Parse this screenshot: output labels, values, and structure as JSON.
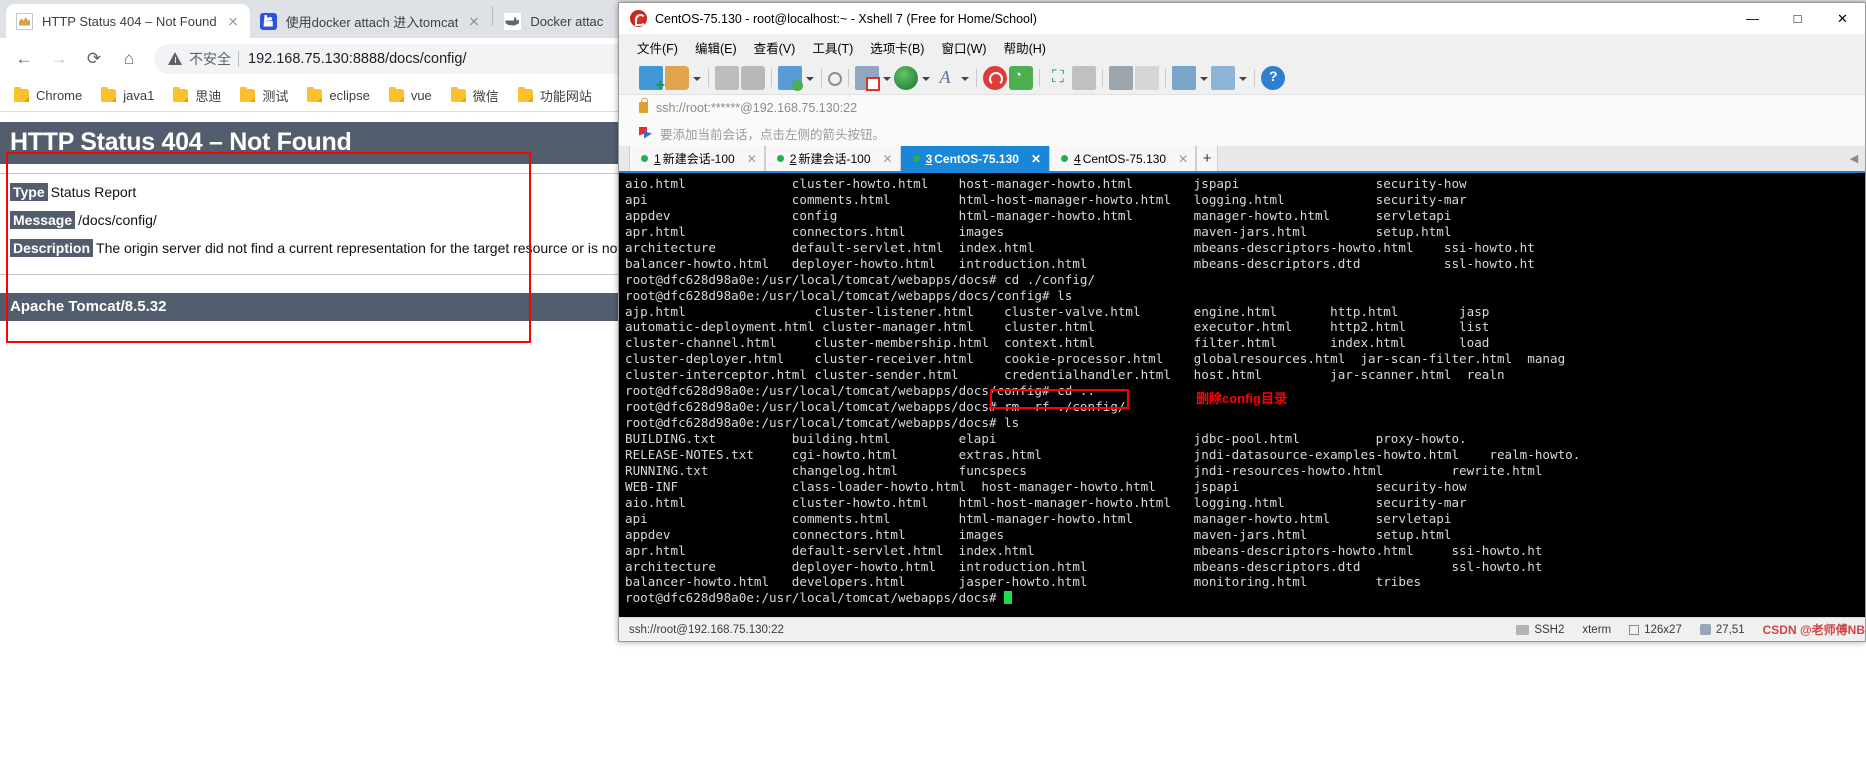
{
  "browser": {
    "tabs": [
      {
        "title": "HTTP Status 404 – Not Found",
        "favicon": "tomcat-icon",
        "active": true
      },
      {
        "title": "使用docker attach 进入tomcat",
        "favicon": "baidu-icon",
        "active": false
      },
      {
        "title": "Docker attac",
        "favicon": "docker-icon",
        "active": false
      }
    ],
    "toolbar": {
      "back": "←",
      "forward": "→",
      "reload": "⟳",
      "home": "⌂",
      "insecure_label": "不安全",
      "url": "192.168.75.130:8888/docs/config/"
    },
    "bookmarks": [
      "Chrome",
      "java1",
      "思迪",
      "测试",
      "eclipse",
      "vue",
      "微信",
      "功能网站"
    ]
  },
  "error_page": {
    "heading": "HTTP Status 404 – Not Found",
    "rows": [
      {
        "key": "Type",
        "value": "Status Report"
      },
      {
        "key": "Message",
        "value": "/docs/config/"
      },
      {
        "key": "Description",
        "value": "The origin server did not find a current representation for the target resource or is not willing to"
      }
    ],
    "footer": "Apache Tomcat/8.5.32"
  },
  "xshell": {
    "title": "CentOS-75.130 - root@localhost:~ - Xshell 7 (Free for Home/School)",
    "window_buttons": {
      "minimize": "—",
      "maximize": "□",
      "close": "✕"
    },
    "menus": [
      "文件(F)",
      "编辑(E)",
      "查看(V)",
      "工具(T)",
      "选项卡(B)",
      "窗口(W)",
      "帮助(H)"
    ],
    "address": "ssh://root:******@192.168.75.130:22",
    "hint": "要添加当前会话，点击左侧的箭头按钮。",
    "tabs": [
      {
        "num": "1",
        "label": "新建会话-100",
        "active": false
      },
      {
        "num": "2",
        "label": "新建会话-100",
        "active": false
      },
      {
        "num": "3",
        "label": "CentOS-75.130",
        "active": true
      },
      {
        "num": "4",
        "label": "CentOS-75.130",
        "active": false
      }
    ],
    "new_tab_label": "+",
    "status": {
      "connection": "ssh://root@192.168.75.130:22",
      "protocol": "SSH2",
      "terminal": "xterm",
      "size": "126x27",
      "cursor": "27,51",
      "watermark": "CSDN @老师傅NB"
    }
  },
  "terminal": {
    "lines": [
      "aio.html              cluster-howto.html    host-manager-howto.html        jspapi                  security-how",
      "api                   comments.html         html-host-manager-howto.html   logging.html            security-mar",
      "appdev                config                html-manager-howto.html        manager-howto.html      servletapi",
      "apr.html              connectors.html       images                         maven-jars.html         setup.html",
      "architecture          default-servlet.html  index.html                     mbeans-descriptors-howto.html    ssi-howto.ht",
      "balancer-howto.html   deployer-howto.html   introduction.html              mbeans-descriptors.dtd           ssl-howto.ht",
      "root@dfc628d98a0e:/usr/local/tomcat/webapps/docs# cd ./config/",
      "root@dfc628d98a0e:/usr/local/tomcat/webapps/docs/config# ls",
      "ajp.html                 cluster-listener.html    cluster-valve.html       engine.html       http.html        jasp",
      "automatic-deployment.html cluster-manager.html    cluster.html             executor.html     http2.html       list",
      "cluster-channel.html     cluster-membership.html  context.html             filter.html       index.html       load",
      "cluster-deployer.html    cluster-receiver.html    cookie-processor.html    globalresources.html  jar-scan-filter.html  manag",
      "cluster-interceptor.html cluster-sender.html      credentialhandler.html   host.html         jar-scanner.html  realn",
      "root@dfc628d98a0e:/usr/local/tomcat/webapps/docs/config# cd ..",
      "root@dfc628d98a0e:/usr/local/tomcat/webapps/docs# rm -rf ./config/",
      "root@dfc628d98a0e:/usr/local/tomcat/webapps/docs# ls",
      "BUILDING.txt          building.html         elapi                          jdbc-pool.html          proxy-howto.",
      "RELEASE-NOTES.txt     cgi-howto.html        extras.html                    jndi-datasource-examples-howto.html    realm-howto.",
      "RUNNING.txt           changelog.html        funcspecs                      jndi-resources-howto.html         rewrite.html",
      "WEB-INF               class-loader-howto.html  host-manager-howto.html     jspapi                  security-how",
      "aio.html              cluster-howto.html    html-host-manager-howto.html   logging.html            security-mar",
      "api                   comments.html         html-manager-howto.html        manager-howto.html      servletapi",
      "appdev                connectors.html       images                         maven-jars.html         setup.html",
      "apr.html              default-servlet.html  index.html                     mbeans-descriptors-howto.html     ssi-howto.ht",
      "architecture          deployer-howto.html   introduction.html              mbeans-descriptors.dtd            ssl-howto.ht",
      "balancer-howto.html   developers.html       jasper-howto.html              monitoring.html         tribes",
      "root@dfc628d98a0e:/usr/local/tomcat/webapps/docs# "
    ],
    "annotation": {
      "command": "rm -rf ./config/",
      "label": "删除config目录"
    },
    "prompt_final": "root@dfc628d98a0e:/usr/local/tomcat/webapps/docs# "
  }
}
